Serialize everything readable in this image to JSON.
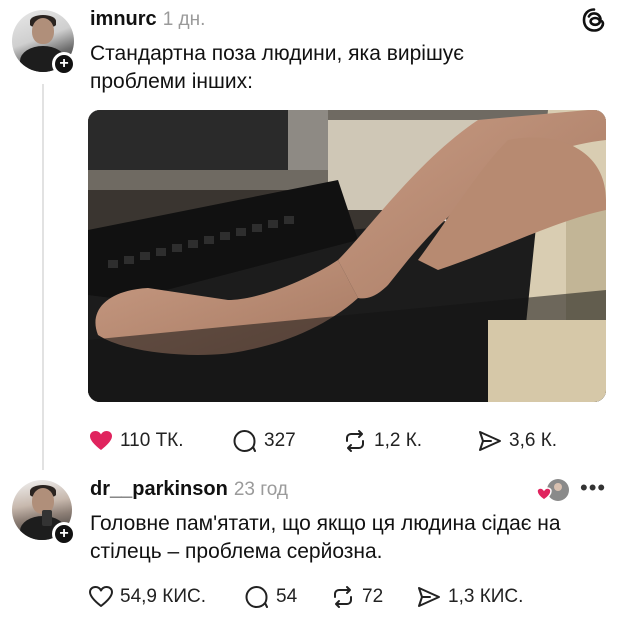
{
  "post1": {
    "username": "imnurc",
    "time": "1 дн.",
    "text_line1": "Стандартна поза людини, яка вирішує",
    "text_line2": "проблеми інших:",
    "likes": "110 ТК.",
    "replies": "327",
    "reposts": "1,2 К.",
    "shares": "3,6 К."
  },
  "post2": {
    "username": "dr__parkinson",
    "time": "23 год",
    "text_line1": "Головне пам'ятати, що якщо ця людина сідає на",
    "text_line2": "стілець – проблема серйозна.",
    "likes": "54,9 КИС.",
    "replies": "54",
    "reposts": "72",
    "shares": "1,3 КИС."
  },
  "icons": {
    "app": "threads-icon",
    "like_filled": "heart-filled-icon",
    "like": "heart-icon",
    "reply": "comment-icon",
    "repost": "repost-icon",
    "share": "send-icon",
    "follow": "plus-icon",
    "more": "more-icon"
  },
  "colors": {
    "like_accent": "#e0245e",
    "muted_text": "#9a9a9a",
    "thread_line": "#e2e2e2"
  }
}
